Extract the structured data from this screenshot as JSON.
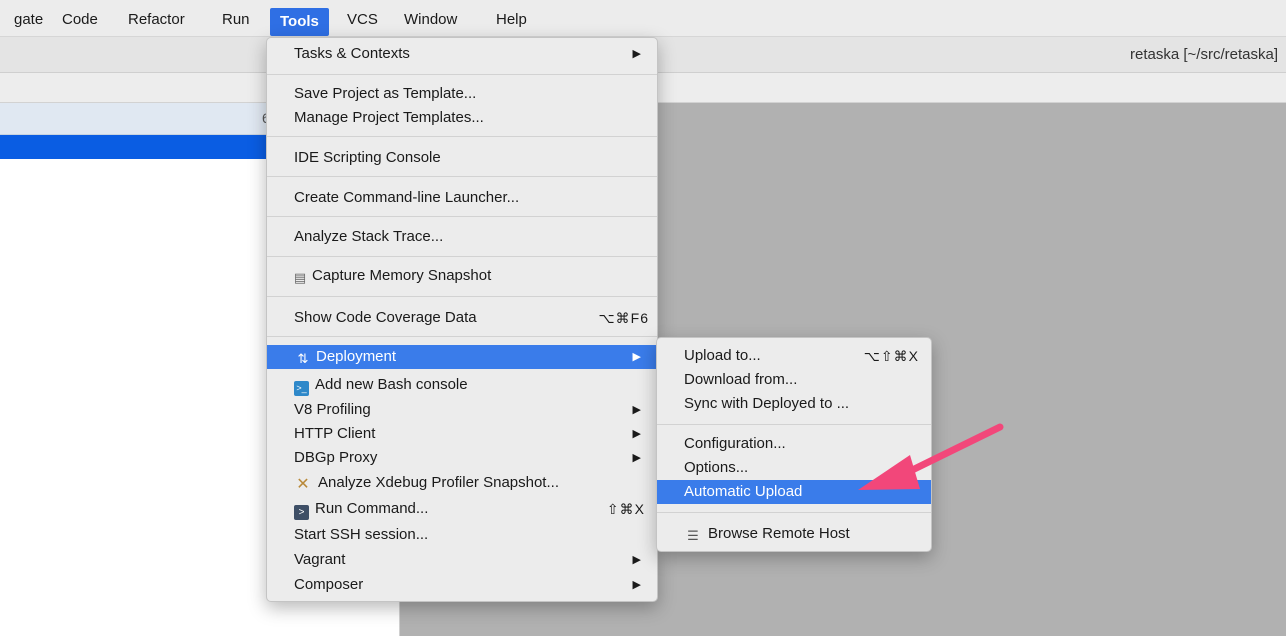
{
  "menubar": {
    "items": [
      "gate",
      "Code",
      "Refactor",
      "Run",
      "Tools",
      "VCS",
      "Window",
      "Help"
    ],
    "active": "Tools"
  },
  "window": {
    "title": "retaska [~/src/retaska]",
    "left_header_digit": "6"
  },
  "tools_menu": {
    "tasks": "Tasks & Contexts",
    "save_template": "Save Project as Template...",
    "manage_templates": "Manage Project Templates...",
    "ide_console": "IDE Scripting Console",
    "cmd_launcher": "Create Command-line Launcher...",
    "analyze_stack": "Analyze Stack Trace...",
    "capture_memory": "Capture Memory Snapshot",
    "coverage": "Show Code Coverage Data",
    "coverage_shortcut": "⌥⌘F6",
    "deployment": "Deployment",
    "bash": "Add new Bash console",
    "v8": "V8 Profiling",
    "http": "HTTP Client",
    "dbgp": "DBGp Proxy",
    "xdebug": "Analyze Xdebug Profiler Snapshot...",
    "run_command": "Run Command...",
    "run_shortcut": "⇧⌘X",
    "ssh": "Start SSH session...",
    "vagrant": "Vagrant",
    "composer": "Composer"
  },
  "deployment_menu": {
    "upload": "Upload to...",
    "upload_shortcut": "⌥⇧⌘X",
    "download": "Download from...",
    "sync": "Sync with Deployed to ...",
    "configuration": "Configuration...",
    "options": "Options...",
    "automatic_upload": "Automatic Upload",
    "browse_remote": "Browse Remote Host"
  },
  "icons": {
    "submenu_arrow": "▶",
    "memory": "memory-snapshot-icon",
    "deployment": "deployment-icon",
    "bash": "bash-console-icon",
    "xdebug": "xdebug-icon",
    "run": "run-command-icon",
    "server": "server-icon"
  },
  "colors": {
    "highlight": "#3a7cea",
    "annotation_arrow": "#f2477a"
  }
}
